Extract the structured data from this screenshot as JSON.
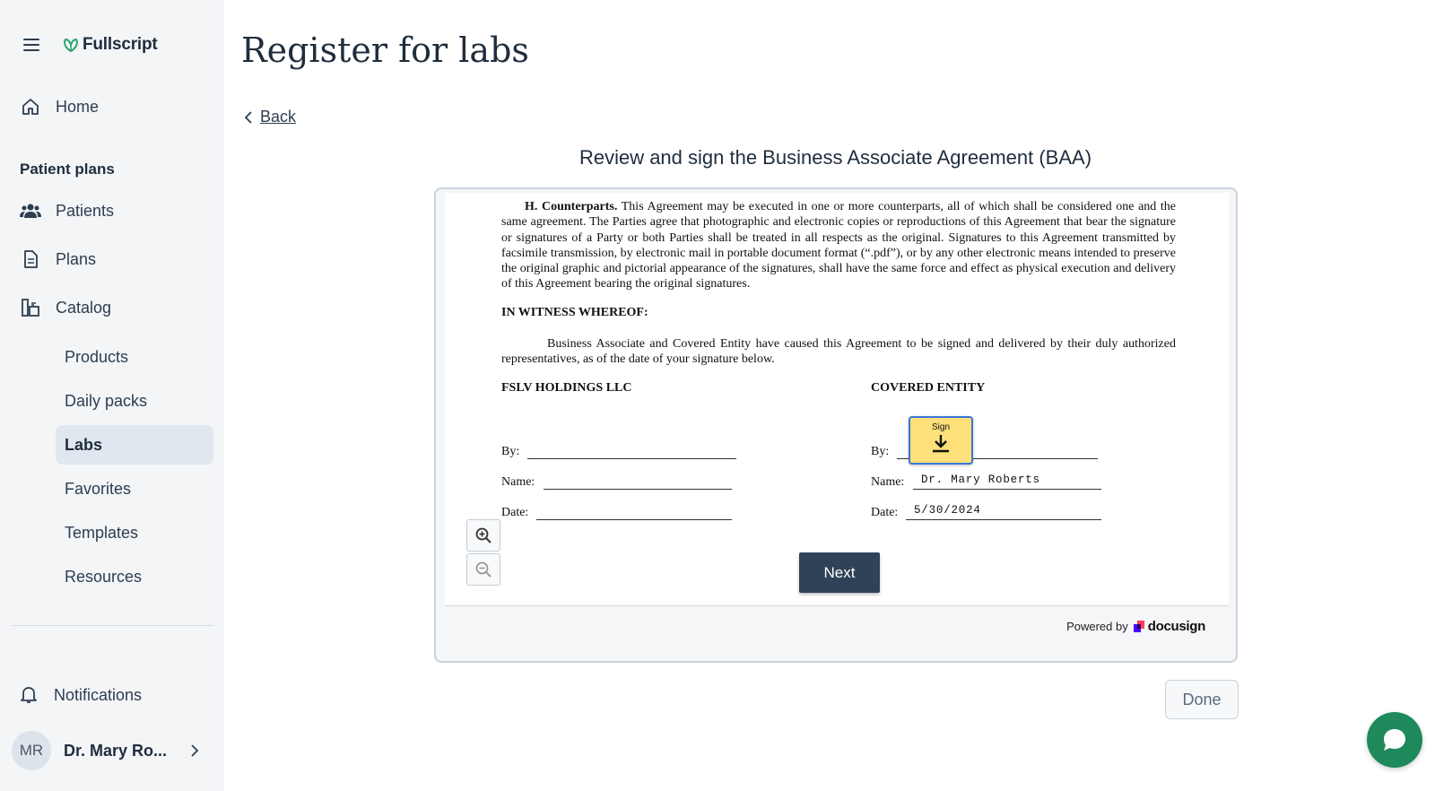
{
  "app": {
    "logo_text": "Fullscript"
  },
  "sidebar": {
    "nav": [
      {
        "label": "Home",
        "icon": "home-icon"
      },
      {
        "label": "Patients",
        "icon": "patients-icon"
      },
      {
        "label": "Plans",
        "icon": "document-icon"
      },
      {
        "label": "Catalog",
        "icon": "catalog-icon"
      }
    ],
    "section_title": "Patient plans",
    "catalog_items": [
      {
        "label": "Products",
        "active": false
      },
      {
        "label": "Daily packs",
        "active": false
      },
      {
        "label": "Labs",
        "active": true
      },
      {
        "label": "Favorites",
        "active": false
      },
      {
        "label": "Templates",
        "active": false
      },
      {
        "label": "Resources",
        "active": false
      }
    ],
    "notifications_label": "Notifications",
    "user": {
      "initials": "MR",
      "name": "Dr. Mary Ro..."
    }
  },
  "main": {
    "title": "Register for labs",
    "back_label": "Back",
    "doc_heading": "Review and sign the Business Associate Agreement (BAA)",
    "document": {
      "counterparts_heading": "H.  Counterparts.",
      "counterparts_text": "This Agreement may be executed in one or more counterparts, all of which shall be considered one and the same agreement. The Parties agree that photographic and electronic copies or reproductions of this Agreement that bear the signature or signatures of a Party or both Parties shall be treated in all respects as the original. Signatures to this Agreement transmitted by facsimile transmission, by electronic mail in portable document format (“.pdf”), or by any other electronic means intended to preserve the original graphic and pictorial appearance of the signatures, shall have the same force and effect as physical execution and delivery of this Agreement bearing the original signatures.",
      "witness_heading": "IN WITNESS WHEREOF:",
      "witness_text": "Business Associate and Covered Entity have caused this Agreement to be signed and delivered by their duly authorized representatives, as of the date of your signature below.",
      "party_left": "FSLV HOLDINGS LLC",
      "party_right": "COVERED ENTITY",
      "by_label": "By:",
      "name_label": "Name:",
      "date_label": "Date:",
      "right_name_value": "Dr. Mary Roberts",
      "right_date_value": "5/30/2024",
      "sign_tag_label": "Sign"
    },
    "next_label": "Next",
    "powered_by": "Powered by",
    "docusign_label": "docusign",
    "done_label": "Done"
  },
  "colors": {
    "brand_green": "#1e8a5c",
    "next_button": "#2f4257",
    "sign_tag": "#fde07a",
    "sidebar_bg": "#f3f5f7",
    "active_item_bg": "#e1e7ee"
  }
}
